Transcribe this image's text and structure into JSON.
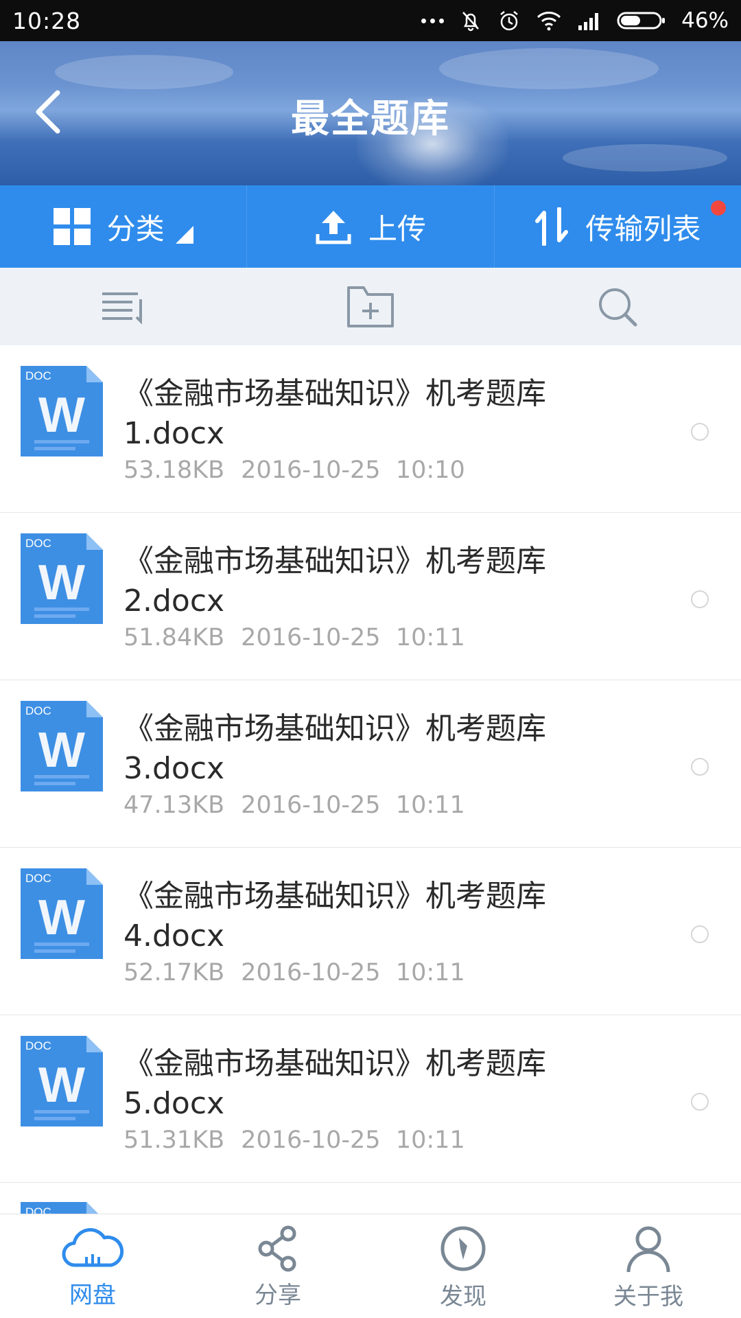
{
  "status_bar": {
    "time": "10:28",
    "battery_text": "46%"
  },
  "header": {
    "title": "最全题库",
    "back_icon": "chevron-left-icon"
  },
  "action_bar": {
    "items": [
      {
        "label": "分类",
        "icon": "grid-icon"
      },
      {
        "label": "上传",
        "icon": "upload-icon"
      },
      {
        "label": "传输列表",
        "icon": "transfer-icon",
        "has_badge": true
      }
    ]
  },
  "toolbar": {
    "icons": [
      "sort-list-icon",
      "new-folder-icon",
      "search-icon"
    ]
  },
  "files": [
    {
      "badge": "DOC",
      "name": "《金融市场基础知识》机考题库1.docx",
      "size": "53.18KB",
      "date": "2016-10-25",
      "time": "10:10"
    },
    {
      "badge": "DOC",
      "name": "《金融市场基础知识》机考题库2.docx",
      "size": "51.84KB",
      "date": "2016-10-25",
      "time": "10:11"
    },
    {
      "badge": "DOC",
      "name": "《金融市场基础知识》机考题库3.docx",
      "size": "47.13KB",
      "date": "2016-10-25",
      "time": "10:11"
    },
    {
      "badge": "DOC",
      "name": "《金融市场基础知识》机考题库4.docx",
      "size": "52.17KB",
      "date": "2016-10-25",
      "time": "10:11"
    },
    {
      "badge": "DOC",
      "name": "《金融市场基础知识》机考题库5.docx",
      "size": "51.31KB",
      "date": "2016-10-25",
      "time": "10:11"
    }
  ],
  "partial_file_badge": "DOC",
  "bottom_nav": {
    "items": [
      {
        "label": "网盘",
        "icon": "cloud-icon",
        "active": true
      },
      {
        "label": "分享",
        "icon": "share-icon",
        "active": false
      },
      {
        "label": "发现",
        "icon": "compass-icon",
        "active": false
      },
      {
        "label": "关于我",
        "icon": "user-icon",
        "active": false
      }
    ]
  },
  "colors": {
    "accent": "#2f8cec",
    "badge_red": "#f2473f",
    "doc_blue": "#3d8fe4",
    "meta_gray": "#a8a8a8",
    "nav_gray": "#7a8794"
  }
}
